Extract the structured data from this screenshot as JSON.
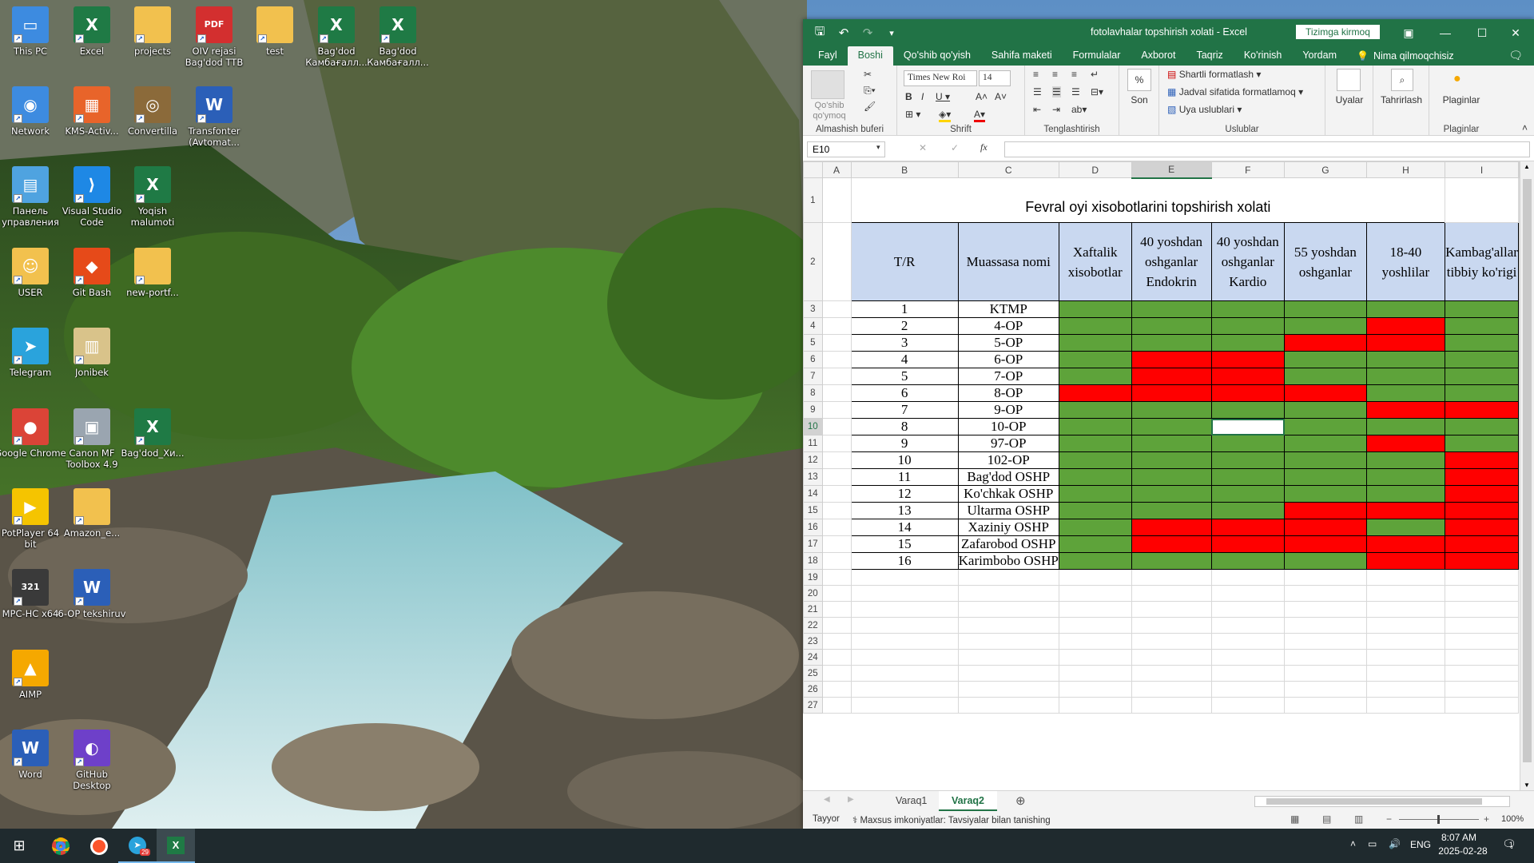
{
  "desktop": {
    "icons": [
      {
        "label": "This PC",
        "icon": "this-pc-icon",
        "color": "#3d8be0",
        "glyph": "▭"
      },
      {
        "label": "Excel",
        "icon": "excel-icon",
        "color": "#1f7a45",
        "glyph": "X"
      },
      {
        "label": "projects",
        "icon": "folder-icon",
        "color": "#f2c14e",
        "glyph": ""
      },
      {
        "label": "OIV rejasi Bag'dod TTB",
        "icon": "pdf-icon",
        "color": "#d32f2f",
        "glyph": "PDF"
      },
      {
        "label": "test",
        "icon": "zip-folder-icon",
        "color": "#f2c14e",
        "glyph": ""
      },
      {
        "label": "Bag'dod Камбағалл...",
        "icon": "excel-file-icon",
        "color": "#1f7a45",
        "glyph": "X"
      },
      {
        "label": "Bag'dod Камбағалл...",
        "icon": "excel-file-icon",
        "color": "#1f7a45",
        "glyph": "X"
      },
      {
        "label": "Network",
        "icon": "network-icon",
        "color": "#3d8be0",
        "glyph": "◉"
      },
      {
        "label": "KMS-Activ...",
        "icon": "kms-icon",
        "color": "#e8642a",
        "glyph": "▦"
      },
      {
        "label": "Convertilla",
        "icon": "convertilla-icon",
        "color": "#8b6a3a",
        "glyph": "◎"
      },
      {
        "label": "Transfonter (Avtomat...",
        "icon": "word-file-icon",
        "color": "#2b5fb8",
        "glyph": "W"
      },
      {
        "label": "Панель управления",
        "icon": "control-panel-icon",
        "color": "#4fa3e0",
        "glyph": "▤"
      },
      {
        "label": "Visual Studio Code",
        "icon": "vscode-icon",
        "color": "#1e88e5",
        "glyph": "⟩"
      },
      {
        "label": "Yoqish malumoti",
        "icon": "excel-file-icon",
        "color": "#1f7a45",
        "glyph": "X"
      },
      {
        "label": "USER",
        "icon": "user-folder-icon",
        "color": "#f2c14e",
        "glyph": "☺"
      },
      {
        "label": "Git Bash",
        "icon": "git-bash-icon",
        "color": "#e64a19",
        "glyph": "◆"
      },
      {
        "label": "new-portf...",
        "icon": "zip-folder-icon",
        "color": "#f2c14e",
        "glyph": ""
      },
      {
        "label": "Telegram",
        "icon": "telegram-icon",
        "color": "#2aa3dc",
        "glyph": "➤"
      },
      {
        "label": "Jonibek",
        "icon": "winrar-icon",
        "color": "#d9c38a",
        "glyph": "▥"
      },
      {
        "label": "Google Chrome",
        "icon": "chrome-icon",
        "color": "#db4437",
        "glyph": "●"
      },
      {
        "label": "Canon MF Toolbox 4.9",
        "icon": "canon-icon",
        "color": "#9aa5b0",
        "glyph": "▣"
      },
      {
        "label": "Bag'dod_Xи...",
        "icon": "excel-file-icon",
        "color": "#1f7a45",
        "glyph": "X"
      },
      {
        "label": "PotPlayer 64 bit",
        "icon": "potplayer-icon",
        "color": "#f5c400",
        "glyph": "▶"
      },
      {
        "label": "Amazon_e...",
        "icon": "zip-folder-icon",
        "color": "#f2c14e",
        "glyph": ""
      },
      {
        "label": "MPC-HC x64",
        "icon": "mpc-hc-icon",
        "color": "#3a3a3a",
        "glyph": "321"
      },
      {
        "label": "6-OP tekshiruv",
        "icon": "word-file-icon",
        "color": "#2b5fb8",
        "glyph": "W"
      },
      {
        "label": "AIMP",
        "icon": "aimp-icon",
        "color": "#f5a800",
        "glyph": "▲"
      },
      {
        "label": "Word",
        "icon": "word-icon",
        "color": "#2b5fb8",
        "glyph": "W"
      },
      {
        "label": "GitHub Desktop",
        "icon": "github-icon",
        "color": "#6e40c9",
        "glyph": "◐"
      }
    ]
  },
  "excel": {
    "title": "fotolavhalar topshirish xolati  -  Excel",
    "signin": "Tizimga kirmoq",
    "tabs": [
      "Fayl",
      "Boshi",
      "Qo'shib qo'yish",
      "Sahifa maketi",
      "Formulalar",
      "Axborot",
      "Taqriz",
      "Ko'rinish",
      "Yordam"
    ],
    "active_tab": "Boshi",
    "tell_me": "Nima qilmoqchisiz",
    "ribbon": {
      "paste": "Qo'shib qo'ymoq",
      "clipboard": "Almashish buferi",
      "font_name": "Times New Roi",
      "font_size": "14",
      "font_group": "Shrift",
      "align_group": "Tenglashtirish",
      "number": "Son",
      "cond_format": "Shartli formatlash",
      "table_format": "Jadval sifatida formatlamoq",
      "cell_styles": "Uya uslublari",
      "styles_group": "Uslublar",
      "cells": "Uyalar",
      "editing": "Tahrirlash",
      "plugins": "Plaginlar",
      "plugins_group": "Plaginlar"
    },
    "name_box": "E10",
    "columns": [
      "A",
      "B",
      "C",
      "D",
      "E",
      "F",
      "G",
      "H",
      "I"
    ],
    "sheet_title": "Fevral oyi xisobotlarini topshirish xolati",
    "headers": [
      "T/R",
      "Muassasa nomi",
      "Xaftalik xisobotlar",
      "40 yoshdan oshganlar Endokrin",
      "40 yoshdan oshganlar Kardio",
      "55 yoshdan oshganlar",
      "18-40 yoshlilar",
      "Kambag'allar tibbiy ko'rigi"
    ],
    "status_colors": {
      "g": "#5ea33a",
      "r": "#ff0000"
    },
    "rows": [
      {
        "n": "1",
        "name": "KTMP",
        "s": "gggggg"
      },
      {
        "n": "2",
        "name": "4-OP",
        "s": "ggggrg"
      },
      {
        "n": "3",
        "name": "5-OP",
        "s": "gggrrg"
      },
      {
        "n": "4",
        "name": "6-OP",
        "s": "grrggg"
      },
      {
        "n": "5",
        "name": "7-OP",
        "s": "grrggg"
      },
      {
        "n": "6",
        "name": "8-OP",
        "s": "rrrrgg"
      },
      {
        "n": "7",
        "name": "9-OP",
        "s": "ggggrr"
      },
      {
        "n": "8",
        "name": "10-OP",
        "s": "ggwggg"
      },
      {
        "n": "9",
        "name": "97-OP",
        "s": "ggggrg"
      },
      {
        "n": "10",
        "name": "102-OP",
        "s": "gggggr"
      },
      {
        "n": "11",
        "name": "Bag'dod OSHP",
        "s": "gggggr"
      },
      {
        "n": "12",
        "name": "Ko'chkak OSHP",
        "s": "gggggr"
      },
      {
        "n": "13",
        "name": "Ultarma OSHP",
        "s": "gggrrr"
      },
      {
        "n": "14",
        "name": "Xaziniy OSHP",
        "s": "grrrgr"
      },
      {
        "n": "15",
        "name": "Zafarobod OSHP",
        "s": "grrrrr"
      },
      {
        "n": "16",
        "name": "Karimbobo OSHP",
        "s": "ggggrr"
      }
    ],
    "row_numbers": [
      "1",
      "2",
      "3",
      "4",
      "5",
      "6",
      "7",
      "8",
      "9",
      "10",
      "11",
      "12",
      "13",
      "14",
      "15",
      "16",
      "17",
      "18",
      "19",
      "20",
      "21",
      "22",
      "23",
      "24",
      "25",
      "26",
      "27"
    ],
    "sheets": [
      "Varaq1",
      "Varaq2"
    ],
    "active_sheet": "Varaq2",
    "status": {
      "ready": "Tayyor",
      "accessibility": "Maxsus imkoniyatlar: Tavsiyalar bilan tanishing",
      "zoom": "100%"
    }
  },
  "taskbar": {
    "lang": "ENG",
    "time": "8:07 AM",
    "date": "2025-02-28",
    "telegram_badge": "29",
    "notif_count": "1"
  }
}
